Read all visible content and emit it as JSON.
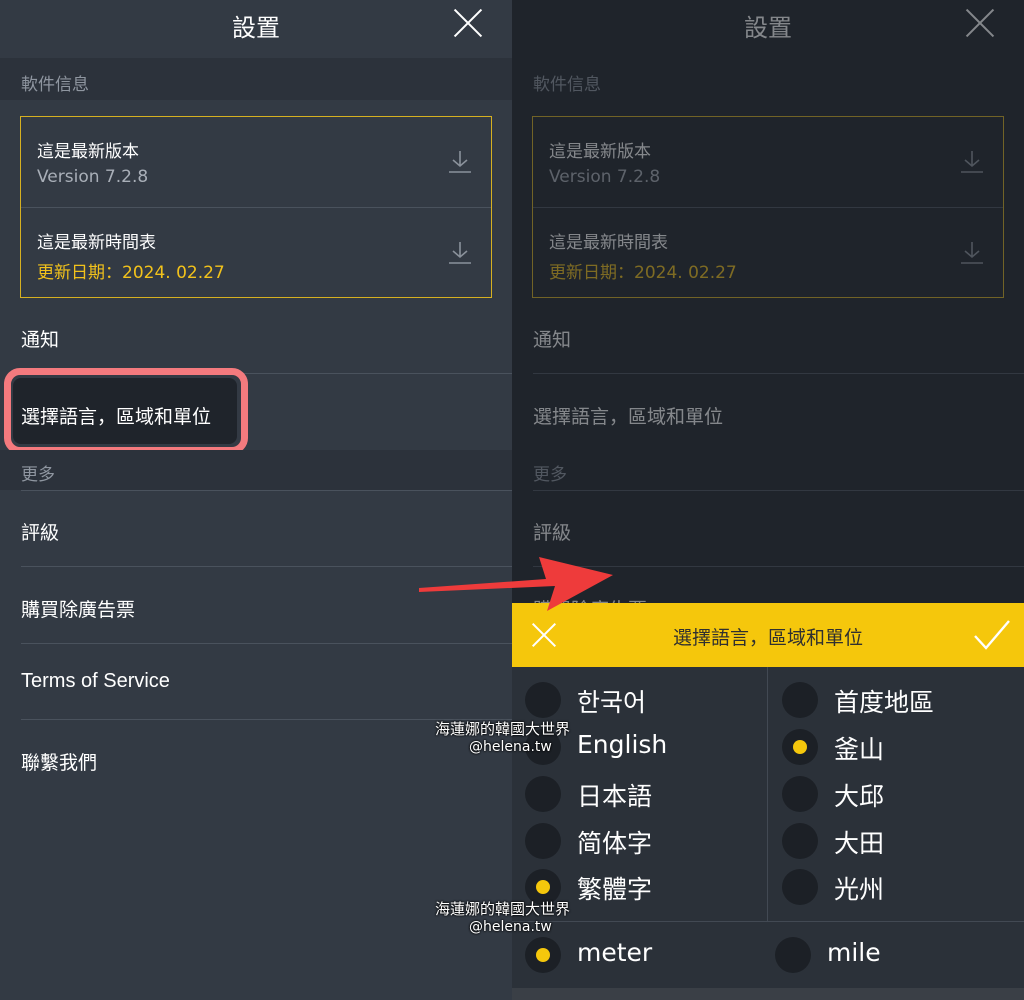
{
  "settings": {
    "title": "設置",
    "section_software": "軟件信息",
    "version_title": "這是最新版本",
    "version_value": "Version 7.2.8",
    "schedule_title": "這是最新時間表",
    "schedule_value": "更新日期：2024. 02.27",
    "notify": "通知",
    "language": "選擇語言，區域和單位",
    "section_more": "更多",
    "rating": "評級",
    "buy_ad_free": "購買除廣告票",
    "terms": "Terms of Service",
    "contact": "聯繫我們"
  },
  "dialog": {
    "title": "選擇語言，區域和單位",
    "languages": [
      {
        "label": "한국어",
        "selected": false
      },
      {
        "label": "English",
        "selected": false
      },
      {
        "label": "日本語",
        "selected": false
      },
      {
        "label": "简体字",
        "selected": false
      },
      {
        "label": "繁體字",
        "selected": true
      }
    ],
    "regions": [
      {
        "label": "首度地區",
        "selected": false
      },
      {
        "label": "釜山",
        "selected": true
      },
      {
        "label": "大邱",
        "selected": false
      },
      {
        "label": "大田",
        "selected": false
      },
      {
        "label": "光州",
        "selected": false
      }
    ],
    "units": [
      {
        "label": "meter",
        "selected": true
      },
      {
        "label": "mile",
        "selected": false
      }
    ]
  },
  "watermark": {
    "name": "海蓮娜的韓國大世界",
    "handle": "@helena.tw"
  },
  "colors": {
    "accent": "#f5c70c",
    "highlight": "#f47a7e",
    "arrow": "#ee3b3b"
  },
  "icons": [
    "close-icon",
    "download-icon",
    "check-icon"
  ]
}
